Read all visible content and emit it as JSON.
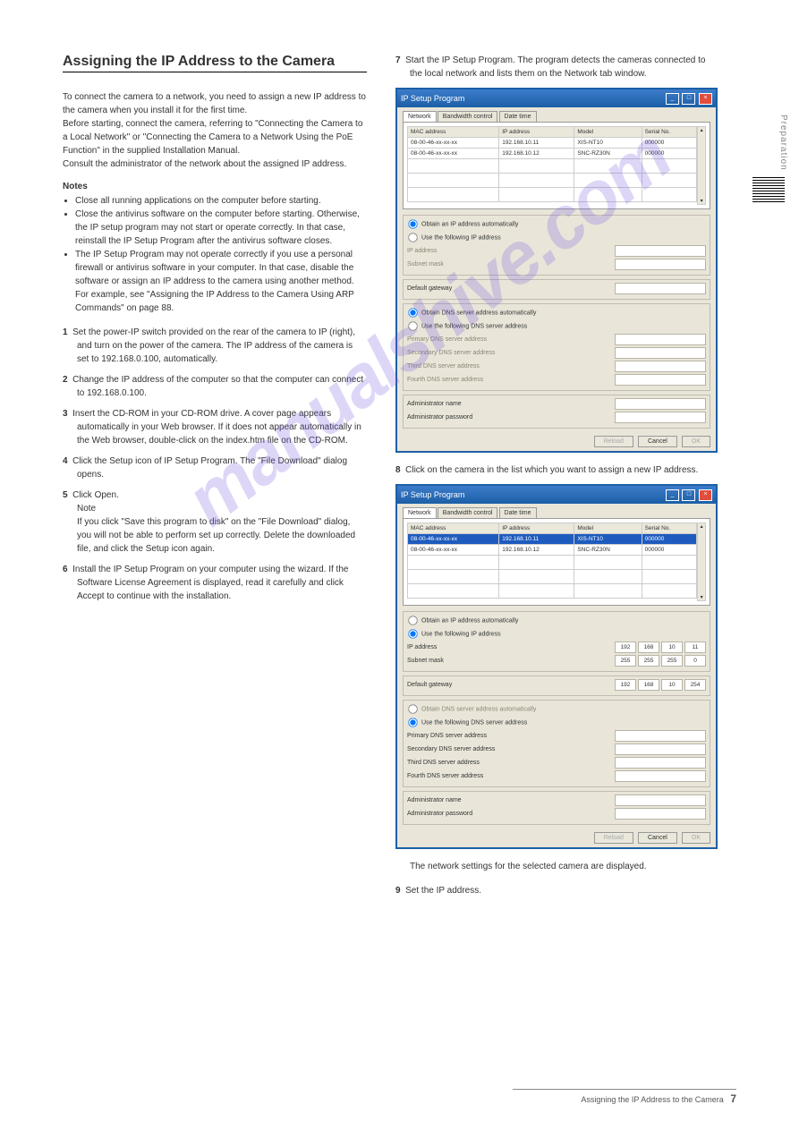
{
  "heading": "Assigning the IP Address to the Camera",
  "intro": "To connect the camera to a network, you need to assign a new IP address to the camera when you install it for the first time.\nBefore starting, connect the camera, referring to \"Connecting the Camera to a Local Network\" or \"Connecting the Camera to a Network Using the PoE Function\" in the supplied Installation Manual.\nConsult the administrator of the network about the assigned IP address.",
  "notes_hd": "Notes",
  "notes": [
    "Close all running applications on the computer before starting.",
    "Close the antivirus software on the computer before starting. Otherwise, the IP setup program may not start or operate correctly. In that case, reinstall the IP Setup Program after the antivirus software closes.",
    "The IP Setup Program may not operate correctly if you use a personal firewall or antivirus software in your computer. In that case, disable the software or assign an IP address to the camera using another method. For example, see \"Assigning the IP Address to the Camera Using ARP Commands\" on page 88."
  ],
  "steps": [
    {
      "n": "1",
      "t": "Set the power-IP switch provided on the rear of the camera to IP (right), and turn on the power of the camera. The IP address of the camera is set to 192.168.0.100, automatically."
    },
    {
      "n": "2",
      "t": "Change the IP address of the computer so that the computer can connect to 192.168.0.100."
    },
    {
      "n": "3",
      "t": "Insert the CD-ROM in your CD-ROM drive. A cover page appears automatically in your Web browser. If it does not appear automatically in the Web browser, double-click on the index.htm file on the CD-ROM."
    },
    {
      "n": "4",
      "t": "Click the Setup icon of IP Setup Program. The \"File Download\" dialog opens."
    },
    {
      "n": "5",
      "t": "Click Open.\nNote\nIf you click \"Save this program to disk\" on the \"File Download\" dialog, you will not be able to perform set up correctly. Delete the downloaded file, and click the Setup icon again."
    },
    {
      "n": "6",
      "t": "Install the IP Setup Program on your computer using the wizard. If the Software License Agreement is displayed, read it carefully and click Accept to continue with the installation."
    }
  ],
  "rsteps": [
    {
      "n": "7",
      "t": "Start the IP Setup Program. The program detects the cameras connected to the local network and lists them on the Network tab window."
    },
    {
      "n": "8",
      "t": "Click on the camera in the list which you want to assign a new IP address."
    },
    {
      "n": "",
      "t": "The network settings for the selected camera are displayed."
    },
    {
      "n": "9",
      "t": "Set the IP address."
    }
  ],
  "dialog": {
    "title": "IP Setup Program",
    "tabs": [
      "Network",
      "Bandwidth control",
      "Date time"
    ],
    "cols": [
      "MAC address",
      "IP address",
      "Model",
      "Serial No."
    ],
    "rows1": [
      {
        "mac": "08-00-46-xx-xx-xx",
        "ip": "192.168.10.11",
        "model": "XIS-NT10",
        "sn": "000000"
      },
      {
        "mac": "08-00-46-xx-xx-xx",
        "ip": "192.168.10.12",
        "model": "SNC-RZ30N",
        "sn": "000000"
      }
    ],
    "rows2": [
      {
        "mac": "08-00-46-xx-xx-xx",
        "ip": "192.168.10.11",
        "model": "XIS-NT10",
        "sn": "000000",
        "sel": true
      },
      {
        "mac": "08-00-46-xx-xx-xx",
        "ip": "192.168.10.12",
        "model": "SNC-RZ30N",
        "sn": "000000"
      }
    ],
    "r_auto_ip": "Obtain an IP address automatically",
    "r_static_ip": "Use the following IP address",
    "l_ip": "IP address",
    "l_mask": "Subnet mask",
    "l_gw": "Default gateway",
    "r_auto_dns": "Obtain DNS server address automatically",
    "r_static_dns": "Use the following DNS server address",
    "l_dns1": "Primary DNS server address",
    "l_dns2": "Secondary DNS server address",
    "l_dns3": "Third DNS server address",
    "l_dns4": "Fourth DNS server address",
    "l_admin": "Administrator name",
    "l_pw": "Administrator password",
    "btn_reload": "Reload",
    "btn_cancel": "Cancel",
    "btn_ok": "OK",
    "oct_ip": [
      "192",
      "168",
      "10",
      "11"
    ],
    "oct_mask": [
      "255",
      "255",
      "255",
      "0"
    ],
    "oct_gw": [
      "192",
      "168",
      "10",
      "254"
    ]
  },
  "side_label": "Preparation",
  "footer1": "Assigning the IP Address to the Camera",
  "footer2": "7",
  "watermark": "manualshive.com"
}
